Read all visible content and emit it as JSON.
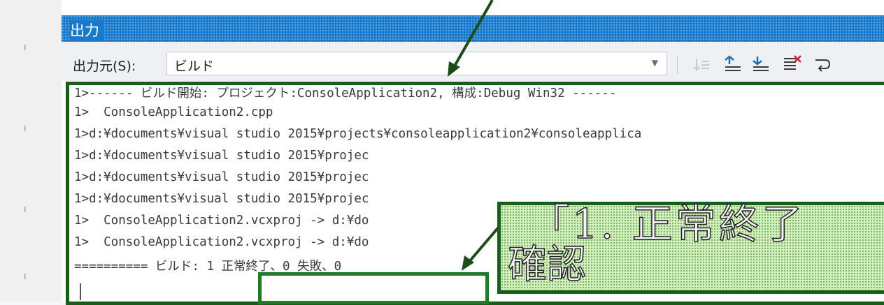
{
  "output_pane": {
    "title": "出力",
    "source_label": "出力元(S):",
    "source_value": "ビルド"
  },
  "output_lines": [
    "1>------ ビルド開始: プロジェクト:ConsoleApplication2, 構成:Debug Win32 ------",
    "1>  ConsoleApplication2.cpp",
    "1>d:¥documents¥visual studio 2015¥projects¥consoleapplication2¥consoleapplica",
    "1>d:¥documents¥visual studio 2015¥projec",
    "1>d:¥documents¥visual studio 2015¥projec",
    "1>d:¥documents¥visual studio 2015¥projec",
    "1>  ConsoleApplication2.vcxproj -> d:¥do",
    "1>  ConsoleApplication2.vcxproj -> d:¥do",
    "========== ビルド: 1 正常終了、0 失敗、0"
  ],
  "callout": {
    "line1": "「1. 正常終了",
    "line2": "確認"
  },
  "colors": {
    "title_bar": "#1979ca",
    "annotation_green": "#1a5c1a",
    "callout_fill": "#d3f0bb"
  }
}
